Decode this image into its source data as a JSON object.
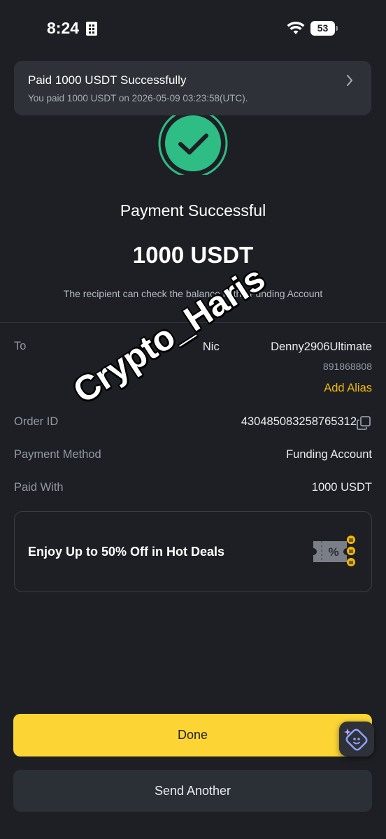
{
  "status_bar": {
    "time": "8:24",
    "battery": "53"
  },
  "banner": {
    "title": "Paid 1000 USDT Successfully",
    "subtitle": "You paid 1000 USDT on 2026-05-09 03:23:58(UTC)."
  },
  "hero": {
    "title": "Payment Successful",
    "amount": "1000 USDT",
    "note": "The recipient can check the balance in the Funding Account"
  },
  "details": {
    "to_label": "To",
    "to_name": "Nic                Denny2906Ultimate",
    "to_id": "891868808",
    "add_alias": "Add Alias",
    "order_label": "Order ID",
    "order_value": "430485083258765312",
    "method_label": "Payment Method",
    "method_value": "Funding Account",
    "paid_with_label": "Paid With",
    "paid_with_value": "1000 USDT"
  },
  "promo": {
    "text": "Enjoy Up to 50% Off in Hot Deals"
  },
  "buttons": {
    "done": "Done",
    "send_another": "Send Another"
  },
  "watermark": "Crypto_Haris",
  "colors": {
    "accent": "#fcd535",
    "success": "#2ebd85",
    "alias": "#f0b90b",
    "background": "#1d1f24"
  }
}
